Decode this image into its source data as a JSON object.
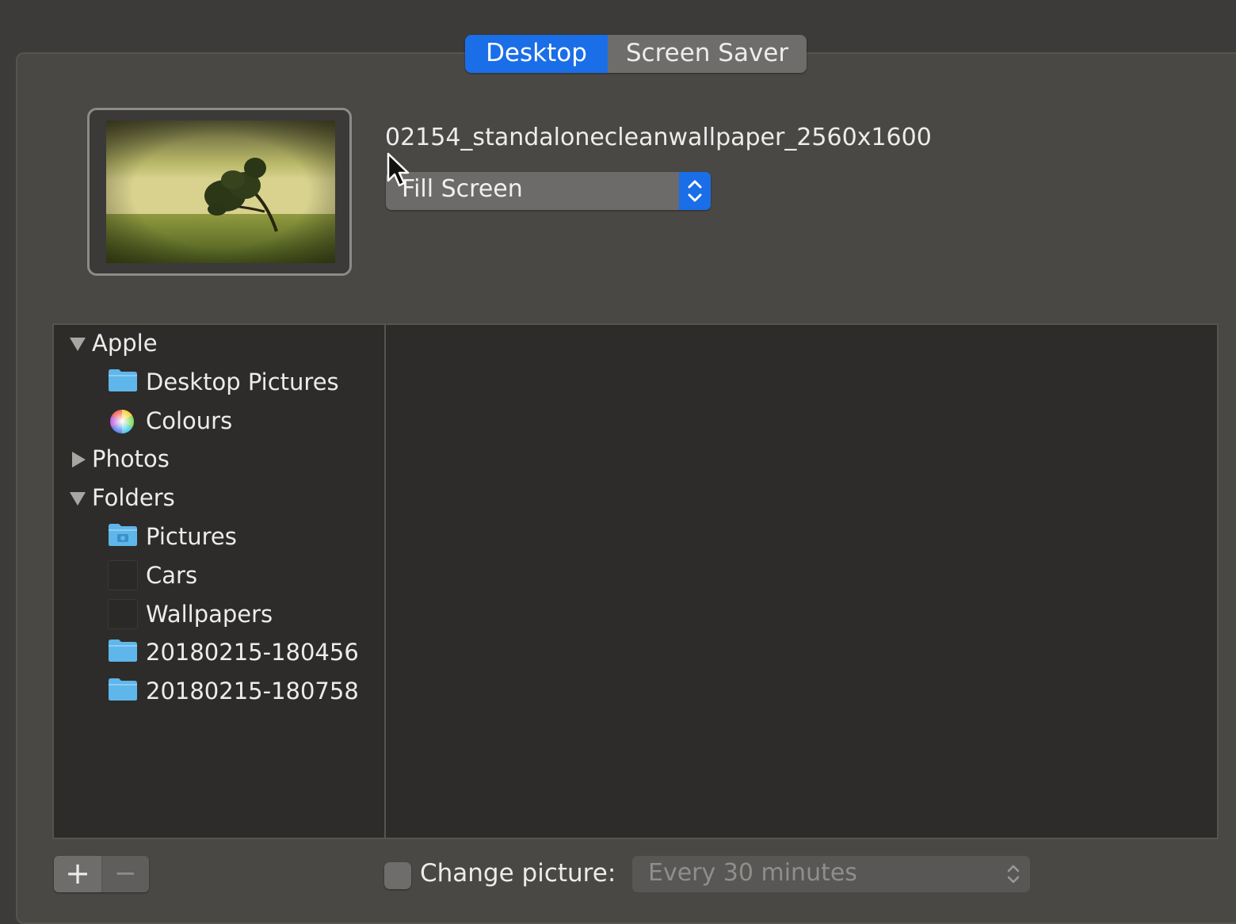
{
  "tabs": [
    {
      "label": "Desktop",
      "active": true
    },
    {
      "label": "Screen Saver",
      "active": false
    }
  ],
  "preview": {
    "filename": "02154_standalonecleanwallpaper_2560x1600",
    "scaling": "Fill Screen"
  },
  "sources": {
    "apple": {
      "label": "Apple",
      "expanded": true,
      "items": [
        {
          "label": "Desktop Pictures",
          "icon": "folder-icon"
        },
        {
          "label": "Colours",
          "icon": "color-wheel-icon"
        }
      ]
    },
    "photos": {
      "label": "Photos",
      "expanded": false
    },
    "folders": {
      "label": "Folders",
      "expanded": true,
      "items": [
        {
          "label": "Pictures",
          "icon": "pictures-folder-icon"
        },
        {
          "label": "Cars",
          "icon": "blank-thumbnail-icon"
        },
        {
          "label": "Wallpapers",
          "icon": "blank-thumbnail-icon"
        },
        {
          "label": "20180215-180456",
          "icon": "folder-icon"
        },
        {
          "label": "20180215-180758",
          "icon": "folder-icon"
        }
      ]
    }
  },
  "bottom": {
    "add_symbol": "+",
    "remove_symbol": "−",
    "change_picture_label": "Change picture:",
    "change_picture_checked": false,
    "interval": "Every 30 minutes"
  },
  "colors": {
    "accent": "#1a6ee7",
    "folder": "#5fb6ea",
    "background": "#3c3b39",
    "list_background": "#2d2c2a"
  }
}
